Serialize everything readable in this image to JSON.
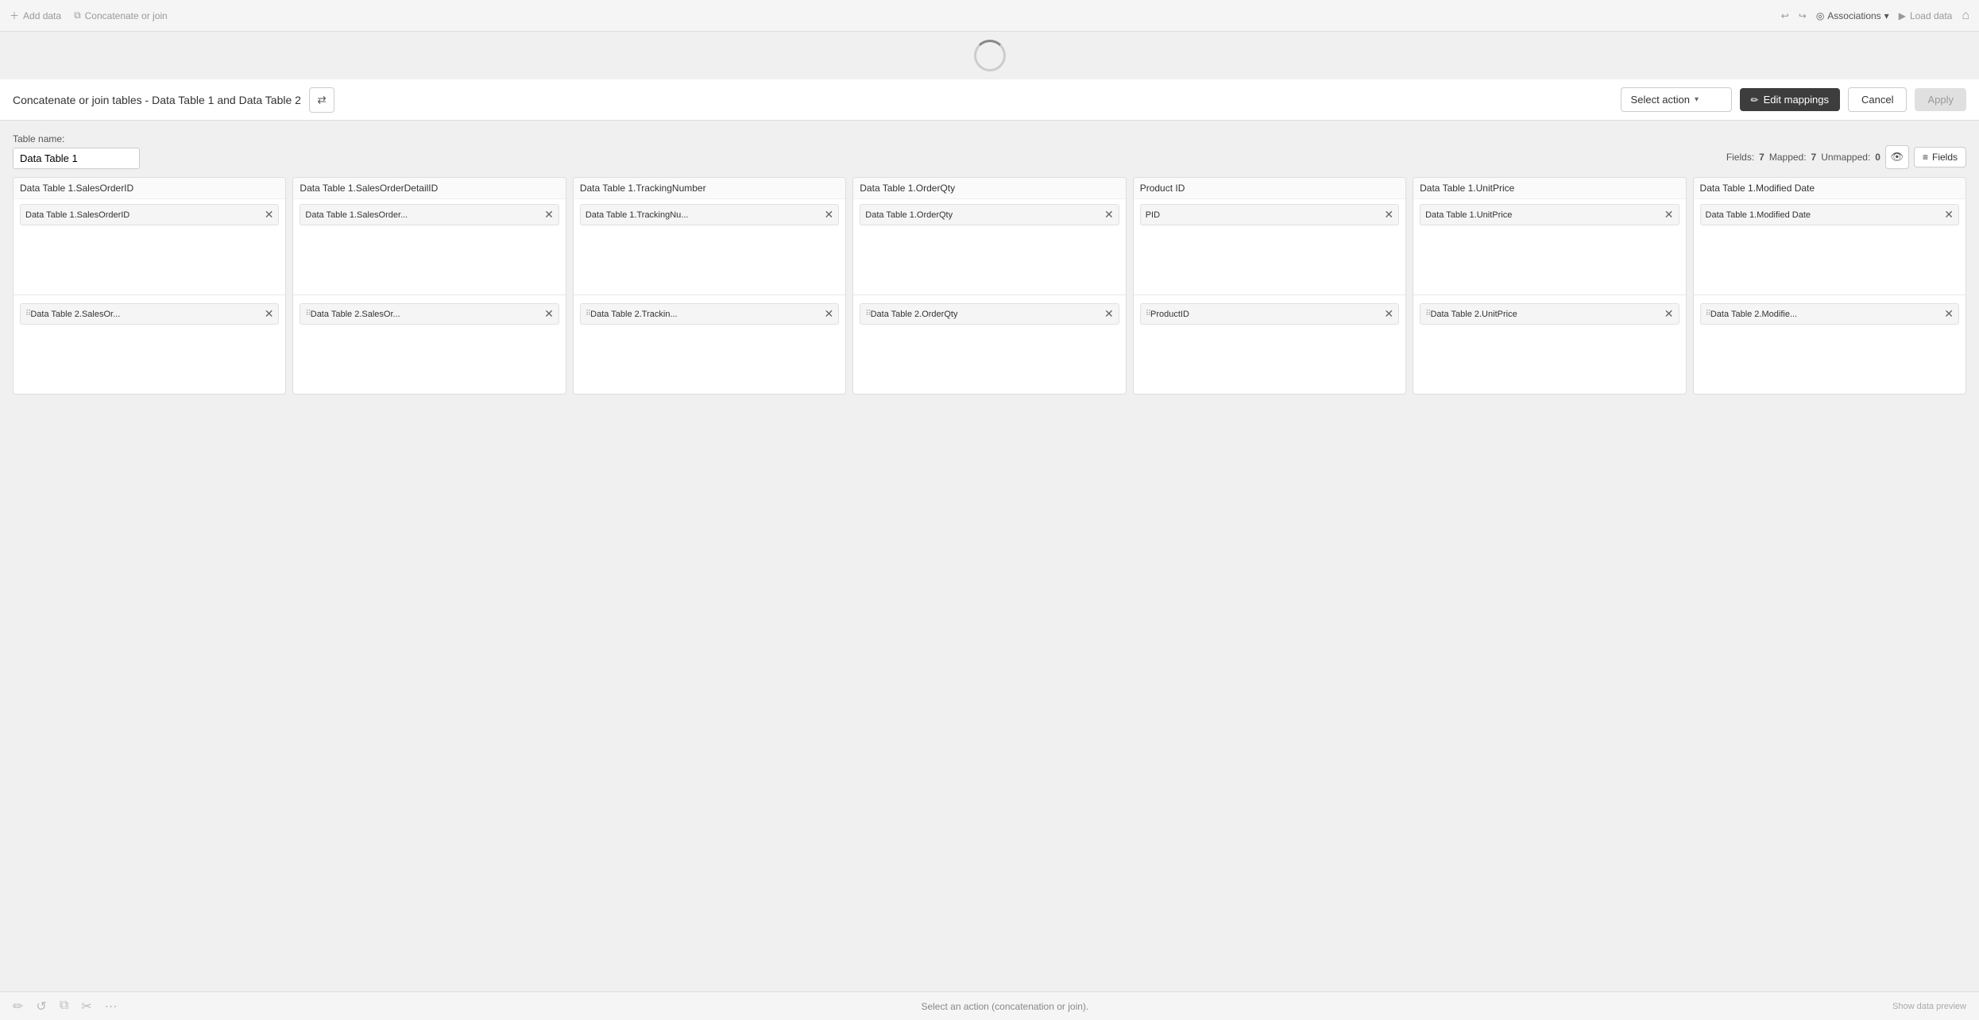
{
  "topNav": {
    "addData": "Add data",
    "concatenateOrJoin": "Concatenate or join",
    "undoIcon": "↩",
    "redoIcon": "↪",
    "associations": "Associations",
    "loadData": "Load data",
    "homeIcon": "⌂"
  },
  "header": {
    "title": "Concatenate or join tables - Data Table 1 and Data Table 2",
    "swapIcon": "⇄",
    "selectAction": "Select action",
    "editMappings": "Edit mappings",
    "cancel": "Cancel",
    "apply": "Apply"
  },
  "tableNameSection": {
    "label": "Table name:",
    "value": "Data Table 1",
    "fieldsLabel": "Fields:",
    "fieldsCount": "7",
    "mappedLabel": "Mapped:",
    "mappedCount": "7",
    "unmappedLabel": "Unmapped:",
    "unmappedCount": "0",
    "fieldsBtn": "Fields"
  },
  "columns": [
    {
      "header": "Data Table 1.SalesOrderID",
      "row1": {
        "text": "Data Table 1.SalesOrderID",
        "hasClose": true
      },
      "row2": {
        "text": "Data Table 2.SalesOr...",
        "hasClose": true,
        "hasDrag": true
      }
    },
    {
      "header": "Data Table 1.SalesOrderDetailID",
      "row1": {
        "text": "Data Table 1.SalesOrder...",
        "hasClose": true
      },
      "row2": {
        "text": "Data Table 2.SalesOr...",
        "hasClose": true,
        "hasDrag": true
      }
    },
    {
      "header": "Data Table 1.TrackingNumber",
      "row1": {
        "text": "Data Table 1.TrackingNu...",
        "hasClose": true
      },
      "row2": {
        "text": "Data Table 2.Trackin...",
        "hasClose": true,
        "hasDrag": true
      }
    },
    {
      "header": "Data Table 1.OrderQty",
      "row1": {
        "text": "Data Table 1.OrderQty",
        "hasClose": true
      },
      "row2": {
        "text": "Data Table 2.OrderQty",
        "hasClose": true,
        "hasDrag": true
      }
    },
    {
      "header": "Product ID",
      "row1": {
        "text": "PID",
        "hasClose": true
      },
      "row2": {
        "text": "ProductID",
        "hasClose": true,
        "hasDrag": true
      }
    },
    {
      "header": "Data Table 1.UnitPrice",
      "row1": {
        "text": "Data Table 1.UnitPrice",
        "hasClose": true
      },
      "row2": {
        "text": "Data Table 2.UnitPrice",
        "hasClose": true,
        "hasDrag": true
      }
    },
    {
      "header": "Data Table 1.Modified Date",
      "row1": {
        "text": "Data Table 1.Modified Date",
        "hasClose": true
      },
      "row2": {
        "text": "Data Table 2.Modifie...",
        "hasClose": true,
        "hasDrag": true
      }
    }
  ],
  "bottomBar": {
    "statusText": "Select an action (concatenation or join).",
    "showDataPreview": "Show data preview"
  }
}
